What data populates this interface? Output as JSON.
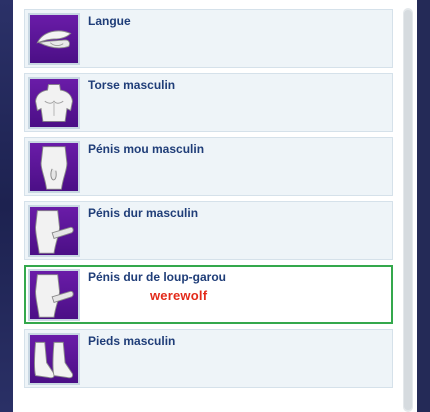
{
  "items": [
    {
      "label": "Langue",
      "icon": "tongue-icon"
    },
    {
      "label": "Torse masculin",
      "icon": "torso-icon"
    },
    {
      "label": "Pénis mou masculin",
      "icon": "soft-penis-icon"
    },
    {
      "label": "Pénis dur masculin",
      "icon": "hard-penis-icon"
    },
    {
      "label": "Pénis dur de loup-garou",
      "icon": "werewolf-penis-icon",
      "tag": "werewolf",
      "selected": true
    },
    {
      "label": "Pieds masculin",
      "icon": "feet-icon"
    }
  ],
  "colors": {
    "thumb_bg": "#5a158f",
    "selected_border": "#34a84c",
    "label": "#1f3d78",
    "tag": "#e32a1a"
  }
}
